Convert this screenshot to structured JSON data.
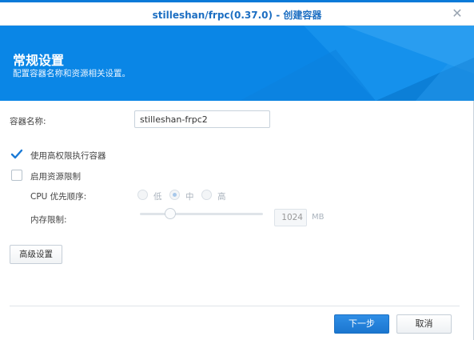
{
  "window": {
    "title": "stilleshan/frpc(0.37.0) - 创建容器",
    "close_icon": "close-icon",
    "accent_color": "#0a86e6"
  },
  "banner": {
    "title": "常规设置",
    "subtitle": "配置容器名称和资源相关设置。"
  },
  "form": {
    "container_name_label": "容器名称:",
    "container_name_value": "stilleshan-frpc2",
    "privileged_label": "使用高权限执行容器",
    "privileged_checked": true,
    "resource_limit_label": "启用资源限制",
    "resource_limit_checked": false,
    "cpu_priority_label": "CPU 优先顺序:",
    "cpu_options": [
      "低",
      "中",
      "高"
    ],
    "cpu_selected": "中",
    "memory_limit_label": "内存限制:",
    "memory_value": "1024",
    "memory_unit": "MB",
    "advanced_button": "高级设置"
  },
  "footer": {
    "next_button": "下一步",
    "cancel_button": "取消"
  }
}
